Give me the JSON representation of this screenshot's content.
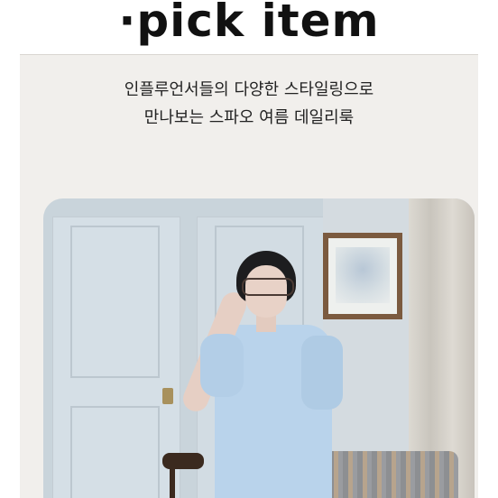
{
  "header": {
    "title": "·pick item"
  },
  "intro": {
    "line1": "인플루언서들의 다양한 스타일링으로",
    "line2": "만나보는 스파오 여름 데일리룩"
  },
  "photo": {
    "subject": "model-photo"
  }
}
